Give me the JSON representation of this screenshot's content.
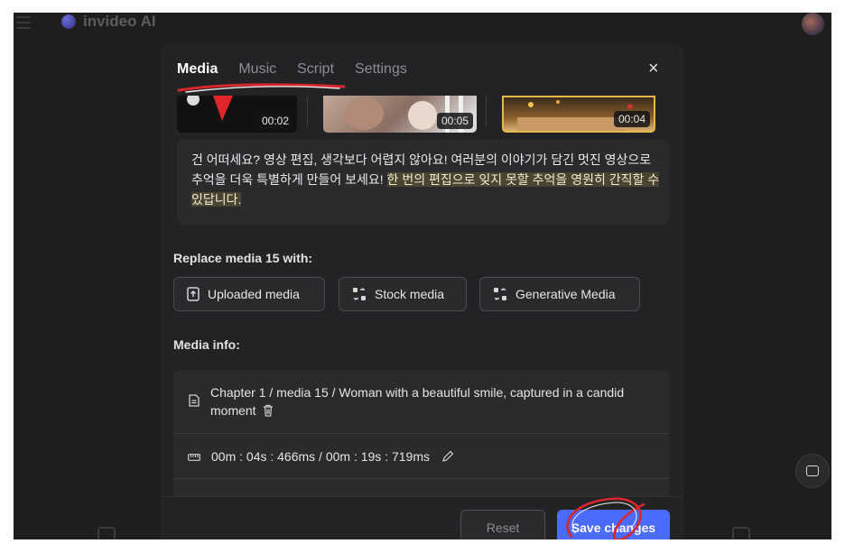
{
  "app": {
    "brand": "invideo AI"
  },
  "modal": {
    "tabs": [
      {
        "label": "Media",
        "active": true
      },
      {
        "label": "Music",
        "active": false
      },
      {
        "label": "Script",
        "active": false
      },
      {
        "label": "Settings",
        "active": false
      }
    ],
    "close_icon": "×",
    "thumbnails": [
      {
        "duration": "00:02"
      },
      {
        "duration": "00:05"
      },
      {
        "duration": "00:04"
      }
    ],
    "script_text_plain": "건 어떠세요? 영상 편집, 생각보다 어렵지 않아요! 여러분의 이야기가 담긴 멋진 영상으로 추억을 더욱 특별하게 만들어 보세요! ",
    "script_text_highlight": "한 번의 편집으로 잊지 못할 추억을 영원히 간직할 수 있답니다.",
    "replace_label": "Replace media 15 with:",
    "replace_options": [
      {
        "label": "Uploaded media",
        "icon": "upload-icon"
      },
      {
        "label": "Stock media",
        "icon": "swap-icon"
      },
      {
        "label": "Generative Media",
        "icon": "swap-icon"
      }
    ],
    "media_info_label": "Media info:",
    "media_info": {
      "description": "Chapter 1 / media 15 / Woman with a beautiful smile, captured in a candid moment",
      "timing": "00m : 04s : 466ms / 00m : 19s : 719ms"
    },
    "footer": {
      "reset_label": "Reset",
      "save_label": "Save changes"
    }
  }
}
